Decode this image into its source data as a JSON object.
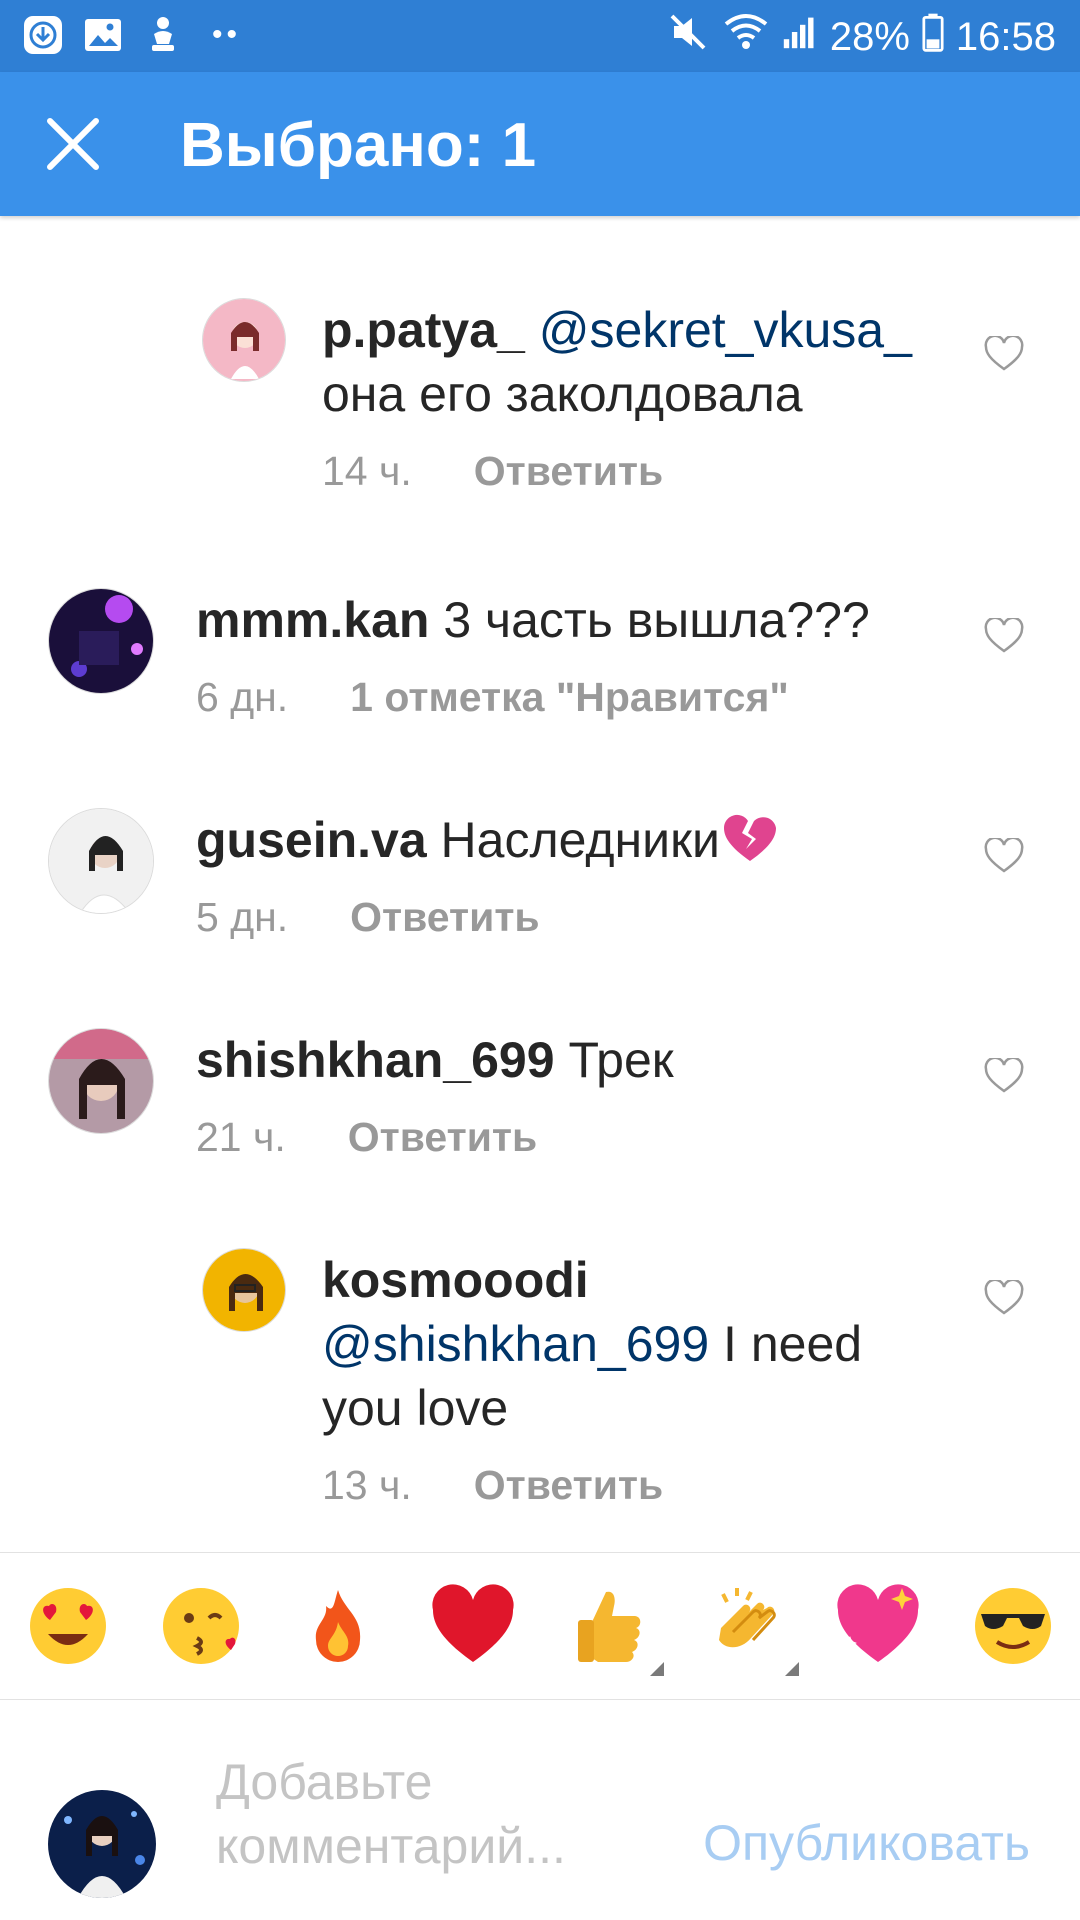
{
  "status_bar": {
    "battery": "28%",
    "time": "16:58",
    "icons": [
      "download-icon",
      "gallery-icon",
      "share-icon",
      "mute-icon",
      "wifi-icon",
      "signal-icon",
      "battery-icon"
    ]
  },
  "app_bar": {
    "title": "Выбрано: 1",
    "close_icon": "close-icon"
  },
  "comments": [
    {
      "username": "p.patya_",
      "mention": "@sekret_vkusa_",
      "text": "она его заколдовала",
      "time": "14 ч.",
      "action": "Ответить",
      "reply": true
    },
    {
      "username": "mmm.kan",
      "mention": "",
      "text": "3 часть вышла???",
      "time": "6 дн.",
      "action": "1 отметка \"Нравится\"",
      "reply": false
    },
    {
      "username": "gusein.va",
      "mention": "",
      "text": "Наследники",
      "emoji": "broken-heart-emoji",
      "time": "5 дн.",
      "action": "Ответить",
      "reply": false
    },
    {
      "username": "shishkhan_699",
      "mention": "",
      "text": "Трек",
      "time": "21 ч.",
      "action": "Ответить",
      "reply": false
    },
    {
      "username": "kosmooodi",
      "mention": "@shishkhan_699",
      "text": "I need you love",
      "text_line1": "I need",
      "text_line2": "you love",
      "time": "13 ч.",
      "action": "Ответить",
      "reply": true
    }
  ],
  "emoji_bar": [
    "heart-eyes-emoji",
    "kiss-emoji",
    "fire-emoji",
    "red-heart-emoji",
    "thumbs-up-emoji",
    "clapping-emoji",
    "sparkling-heart-emoji",
    "sunglasses-emoji"
  ],
  "composer": {
    "placeholder_line1": "Добавьте",
    "placeholder_line2": "комментарий...",
    "publish_label": "Опубликовать"
  },
  "colors": {
    "status_bar": "#2f7fd4",
    "app_bar": "#3a91ea",
    "mention": "#003569",
    "meta": "#999999",
    "publish": "#a8cdf3"
  }
}
